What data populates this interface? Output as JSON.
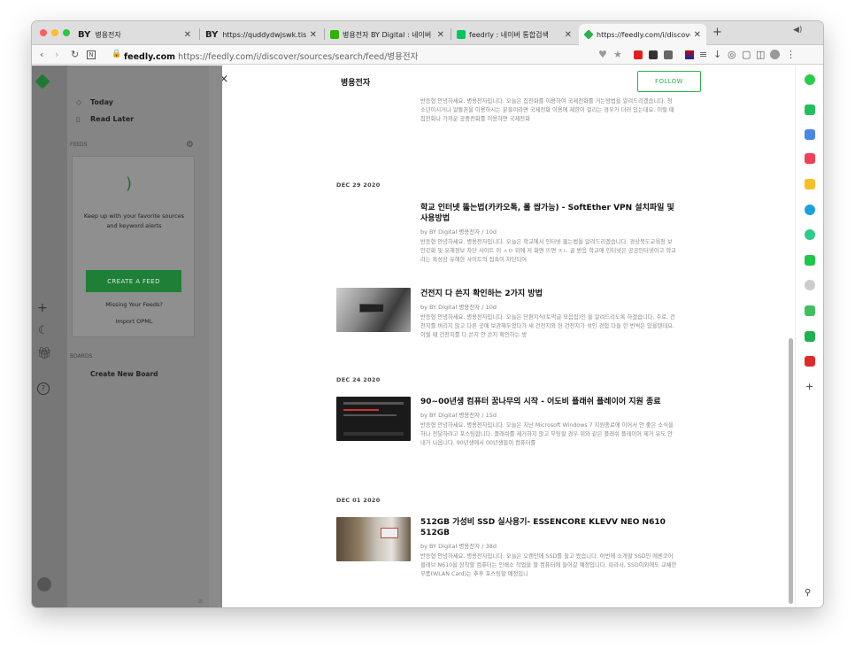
{
  "browser": {
    "tabs": [
      {
        "icon": "BY",
        "label": "병용전자"
      },
      {
        "icon": "BY",
        "label": "https://quddydwjswk.tistory.c"
      },
      {
        "icon": "naver",
        "label": "병용전자 BY Digital : 네이버 블로"
      },
      {
        "icon": "naver",
        "label": "feedrly : 네이버 통합검색"
      },
      {
        "icon": "feedly",
        "label": "https://feedly.com/i/discover/"
      }
    ],
    "url_host": "feedly.com",
    "url_rest": " https://feedly.com/i/discover/sources/search/feed/병용전자",
    "new_tab": "+"
  },
  "sidebar": {
    "today": "Today",
    "read_later": "Read Later",
    "feeds_header": "FEEDS",
    "feeds_message": "Keep up with your favorite sources and keyword alerts",
    "create_feed": "CREATE A FEED",
    "missing_feeds": "Missing Your Feeds?",
    "import_opml": "Import OPML",
    "boards_header": "BOARDS",
    "create_board": "Create New Board"
  },
  "panel": {
    "close": "×",
    "title": "병용전자",
    "follow": "FOLLOW",
    "top_snippet": "반응형 안녕하세요. 병용전자입니다. 오늘은 집전화를 이용하여 국제전화를 거는방법을 알려드리겠습니다. 청소년이시거나 알뜰폰을 이용하시는 분들이라면 국제전화 이용에 제한이 걸리는 경우가 더러 있는데요. 이럴 때 집전화나 가까운 공중전화를 이용하면 국제전화",
    "groups": [
      {
        "date": "DEC 29 2020",
        "articles": [
          {
            "title": "학교 인터넷 뚫는법(카카오톡, 롤 쌉가능) - SoftEther VPN 설치파일 및 사용방법",
            "by": "by BY Digital 병용전자 / 10d",
            "snippet": "반응형 안녕하세요. 병용전자입니다. 오늘은 학교에서 인터넷 뚫는법을 알려드리겠습니다. 경상북도교육청 보안강화 및 유해정보 차단 사이트 이 ㅅㅁ 위에 저 화면 뜨면 ㅈㄴ 골 받음 학교에 인터넷은 공공인터넷이고 학교라는 특성상 유해한 사이트의 접속이 차단되어"
          },
          {
            "title": "건전지 다 쓴지 확인하는 2가지 방법",
            "by": "by BY Digital 병용전자 / 10d",
            "snippet": "반응형 안녕하세요. 병용전자입니다. 오늘은 단편지식(토막글 모음집)인 을 알려드리도록 하겠습니다. 주로, 건전지를 버리지 않고 다른 곳에 보관해두었다가 새 건전지와 헌 건전지가 섞인 경험 다들 한 번씩은 있을텐데요. 이럴 때 건전지를 다 쓴지 안 쓴지 확인하는 방"
          }
        ]
      },
      {
        "date": "DEC 24 2020",
        "articles": [
          {
            "title": "90~00년생 컴퓨터 꿈나무의 시작 - 어도비 플래쉬 플레이어 지원 종료",
            "by": "by BY Digital 병용전자 / 15d",
            "snippet": "반응형 안녕하세요. 병용전자입니다. 오늘은 지난 Microsoft Windows 7 지원종료에 이어서 안 좋은 소식을 하나 전달하려고 포스팅합니다. 플래쉬를 제거하지 않고 부팅할 경우 위와 같은 플래쉬 플레이어 제거 유도 안내가 나옵니다. 90년생에서 00년생들이 컴퓨터를"
          }
        ]
      },
      {
        "date": "DEC 01 2020",
        "articles": [
          {
            "title": "512GB 가성비 SSD 실사용기- ESSENCORE KLEVV NEO N610 512GB",
            "by": "by BY Digital 병용전자 / 38d",
            "snippet": "반응형 안녕하세요. 병용전자입니다. 오늘은 오랜만에 SSD를 들고 왔습니다. 이번에 소개할 SSD인 에센코어 클레브 N610을 장착할 컴퓨터는 인쇄소 작업을 할 컴퓨터에 들어갈 예정입니다. 따라서, SSD이외에도 교체한 부품(WLAN Card)는 추후 포스팅할 예정입니"
          }
        ]
      }
    ]
  },
  "colors": {
    "feedly_green": "#2bb24c"
  }
}
